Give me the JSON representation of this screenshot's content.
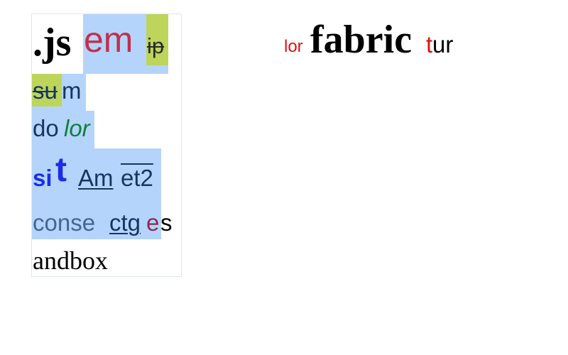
{
  "textbox": {
    "line1": {
      "a": ".js",
      "b": "em",
      "c": "ip"
    },
    "line2": {
      "a": "su",
      "b": "m"
    },
    "line3": {
      "a": "do",
      "b": "lor"
    },
    "line4": {
      "a": "si",
      "b": "t",
      "c": "Am",
      "d": "et2"
    },
    "line5": {
      "a": "conse",
      "b": "ctg",
      "c": "e",
      "d": "s"
    },
    "line6": {
      "a": "andbox"
    }
  },
  "standalone": {
    "a": "lor",
    "b": "fabric",
    "c": "t",
    "d": "ur"
  },
  "colors": {
    "selection": "#b5d4fb",
    "green_highlight": "#bcd55a",
    "crimson": "#c0304d",
    "navy": "#153564",
    "italic_green": "#10803a",
    "blue": "#1a2eea",
    "steel": "#48658f",
    "red": "#e01010"
  }
}
